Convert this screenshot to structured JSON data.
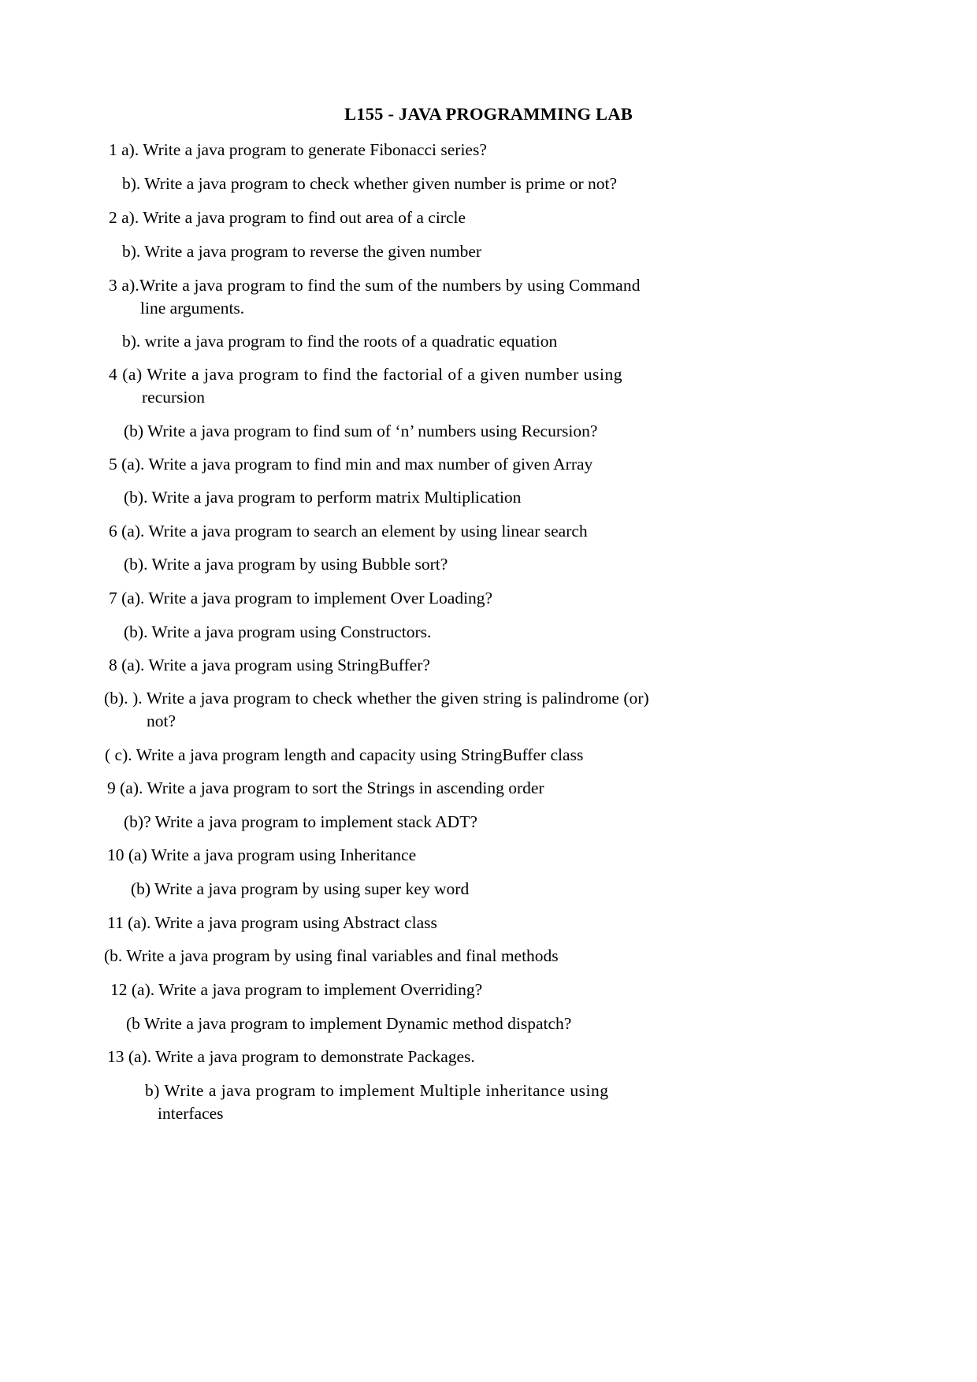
{
  "document": {
    "title": "L155 - JAVA PROGRAMMING LAB",
    "items": [
      {
        "id": "q1a",
        "text": "1 a). Write a java program   to generate Fibonacci series?"
      },
      {
        "id": "q1b",
        "text": "b). Write a java program   to check whether given number is prime or not?"
      },
      {
        "id": "q2a",
        "text": "2 a). Write a java program to find out area of a circle"
      },
      {
        "id": "q2b",
        "text": "b). Write a java program   to reverse the given number"
      },
      {
        "id": "q3a_line1",
        "text": "3  a).Write  a  java  program  to  find  the  sum  of  the  numbers  by  using  Command"
      },
      {
        "id": "q3a_line2",
        "text": "line arguments."
      },
      {
        "id": "q3b",
        "text": "b). write a java program  to find the roots of a quadratic equation"
      },
      {
        "id": "q4a_line1",
        "text": "4  (a)  Write  a  java  program  to  find  the  factorial  of  a  given  number  using"
      },
      {
        "id": "q4a_line2",
        "text": "recursion"
      },
      {
        "id": "q4b",
        "text": "(b) Write a java program to find sum of ‘n’ numbers using Recursion?"
      },
      {
        "id": "q5a",
        "text": "5 (a). Write a java program to find min and max number of given Array"
      },
      {
        "id": "q5b",
        "text": "(b). Write a java program to perform matrix Multiplication"
      },
      {
        "id": "q6a",
        "text": "6 (a). Write a java program to search an element by using linear search"
      },
      {
        "id": "q6b",
        "text": "(b). Write a java program by using Bubble sort?"
      },
      {
        "id": "q7a",
        "text": "7 (a). Write a java program  to implement Over Loading?"
      },
      {
        "id": "q7b",
        "text": "(b). Write a java program using Constructors."
      },
      {
        "id": "q8a",
        "text": "8 (a).  Write a java program using StringBuffer?"
      },
      {
        "id": "q8b_line1",
        "text": "(b).  ).  Write  a  java  program  to  check  whether  the  given  string  is  palindrome  (or)"
      },
      {
        "id": "q8b_line2",
        "text": "not?"
      },
      {
        "id": "q8c",
        "text": "( c).  Write a java program length and capacity using StringBuffer class"
      },
      {
        "id": "q9a",
        "text": "9 (a). Write a java program  to sort the Strings in ascending order"
      },
      {
        "id": "q9b",
        "text": "(b)? Write a java program to implement stack ADT?"
      },
      {
        "id": "q10a",
        "text": "10 (a)  Write a java program using Inheritance"
      },
      {
        "id": "q10b",
        "text": "(b) Write a java program by using super key word"
      },
      {
        "id": "q11a",
        "text": "11 (a).   Write a java program using Abstract class"
      },
      {
        "id": "q11b",
        "text": "(b. Write a java program   by using final variables and final methods"
      },
      {
        "id": "q12a",
        "text": "12 (a). Write a java program to implement  Overriding?"
      },
      {
        "id": "q12b",
        "text": "(b Write a java program to implement Dynamic method dispatch?"
      },
      {
        "id": "q13a",
        "text": "13 (a). Write a java program   to demonstrate Packages."
      },
      {
        "id": "q13b_line1",
        "text": "b)    Write    a    java    program      to    implement    Multiple    inheritance    using"
      },
      {
        "id": "q13b_line2",
        "text": "interfaces"
      }
    ]
  }
}
